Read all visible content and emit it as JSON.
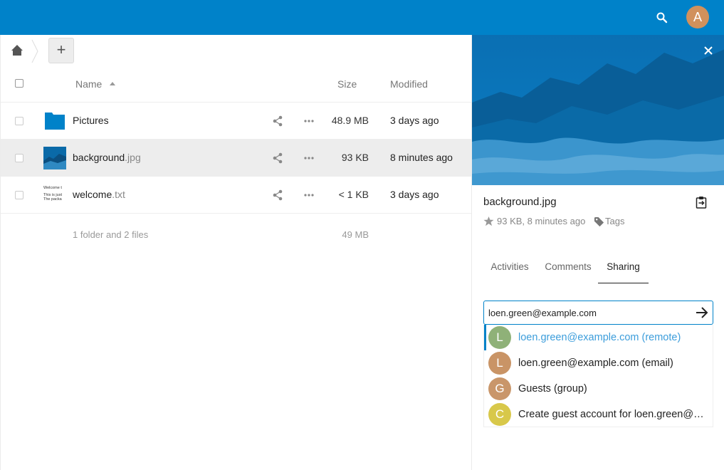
{
  "colors": {
    "primary": "#0082c9",
    "avatar_user": "#d1915c"
  },
  "header": {
    "user_initial": "A"
  },
  "controls": {
    "add_label": "+"
  },
  "table": {
    "headers": {
      "name": "Name",
      "size": "Size",
      "modified": "Modified"
    },
    "rows": [
      {
        "name": "Pictures",
        "ext": "",
        "size": "48.9 MB",
        "modified": "3 days ago",
        "type": "folder"
      },
      {
        "name": "background",
        "ext": ".jpg",
        "size": "93 KB",
        "modified": "8 minutes ago",
        "type": "image"
      },
      {
        "name": "welcome",
        "ext": ".txt",
        "size": "< 1 KB",
        "modified": "3 days ago",
        "type": "text"
      }
    ],
    "summary": {
      "text": "1 folder and 2 files",
      "size": "49 MB"
    },
    "text_thumb": [
      "Welcome t",
      "This is just",
      "The packa"
    ]
  },
  "sidebar": {
    "file_name": "background.jpg",
    "meta": "93 KB, 8 minutes ago",
    "tags_label": "Tags",
    "tabs": [
      {
        "label": "Activities",
        "active": false
      },
      {
        "label": "Comments",
        "active": false
      },
      {
        "label": "Sharing",
        "active": true
      }
    ],
    "share_input_value": "loen.green@example.com",
    "suggestions": [
      {
        "initial": "L",
        "label": "loen.green@example.com (remote)",
        "color": "#8fb178",
        "active": true
      },
      {
        "initial": "L",
        "label": "loen.green@example.com (email)",
        "color": "#c99466",
        "active": false
      },
      {
        "initial": "G",
        "label": "Guests (group)",
        "color": "#c9966a",
        "active": false
      },
      {
        "initial": "C",
        "label": "Create guest account for loen.green@example.com",
        "color": "#d8c84a",
        "active": false
      }
    ]
  }
}
